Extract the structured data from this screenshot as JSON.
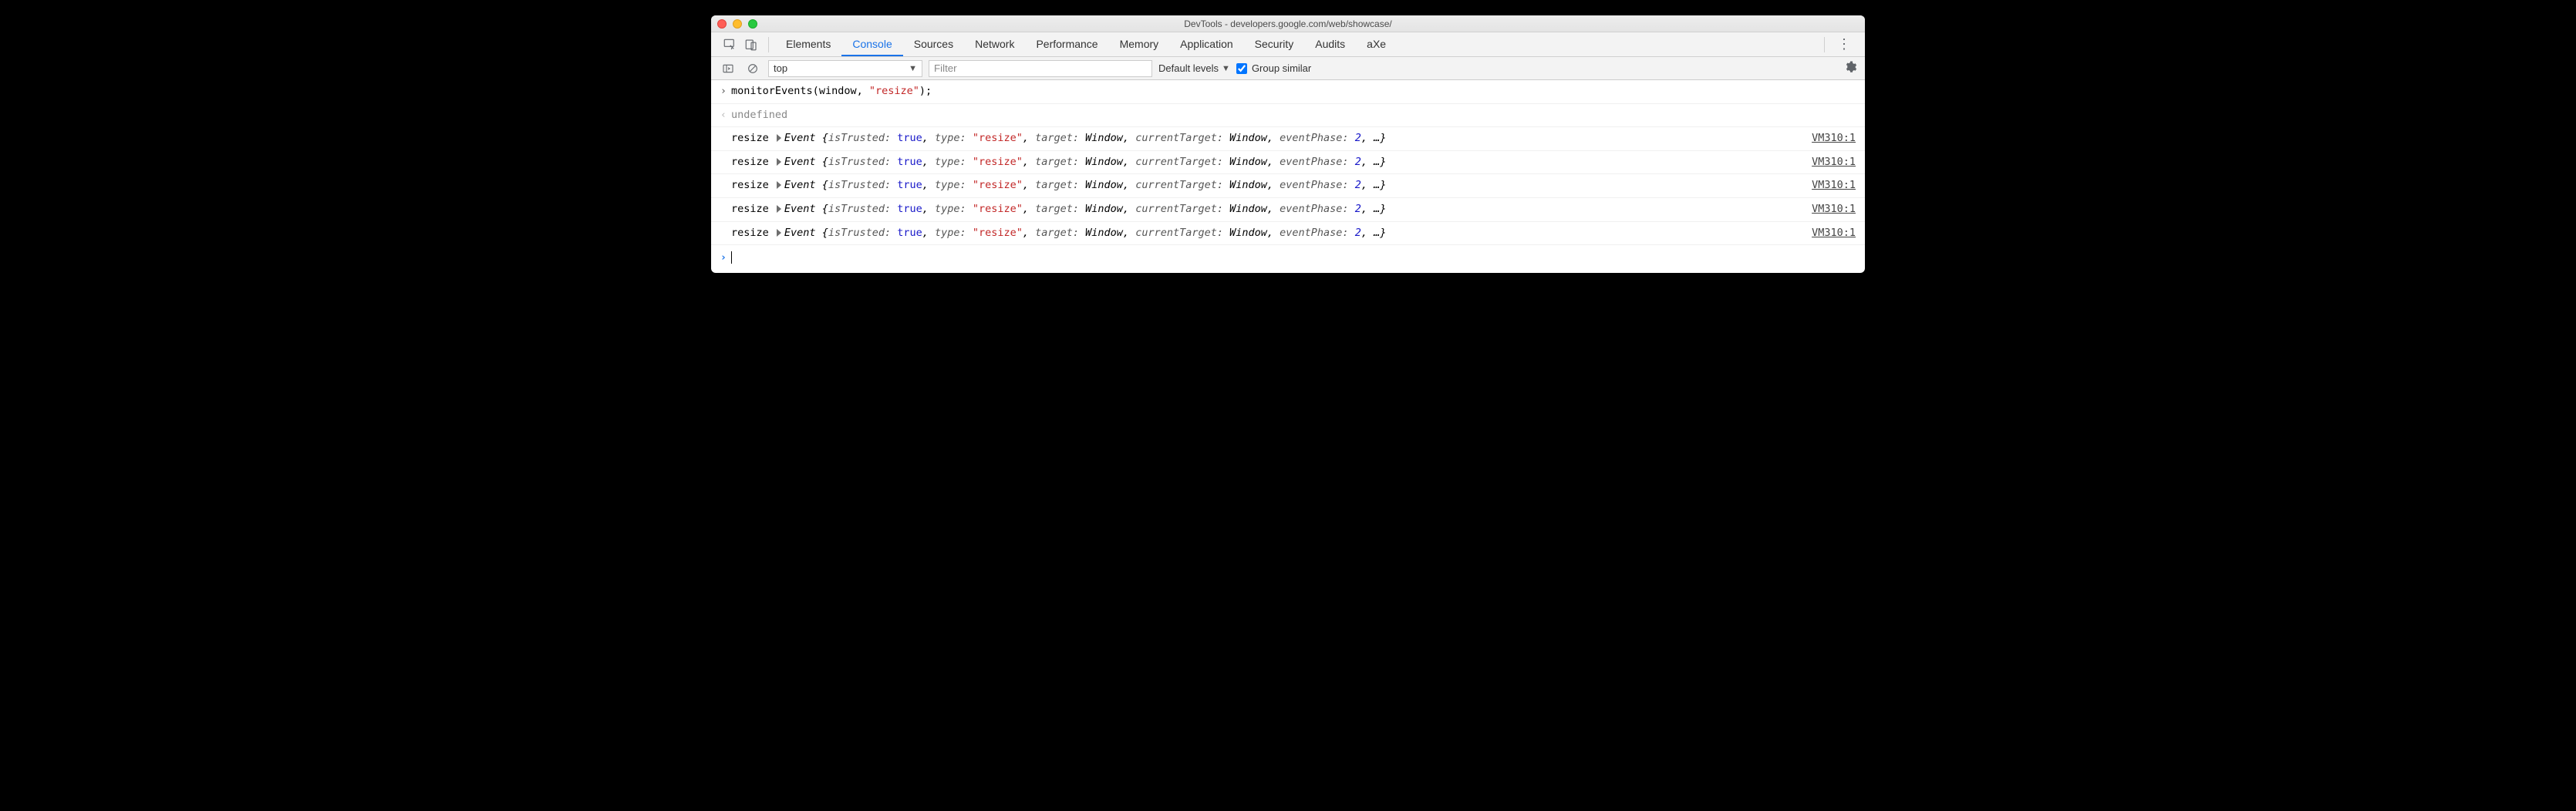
{
  "window": {
    "title": "DevTools - developers.google.com/web/showcase/"
  },
  "tabs": {
    "items": [
      "Elements",
      "Console",
      "Sources",
      "Network",
      "Performance",
      "Memory",
      "Application",
      "Security",
      "Audits",
      "aXe"
    ],
    "active_index": 1
  },
  "console_toolbar": {
    "context": "top",
    "filter_placeholder": "Filter",
    "levels_label": "Default levels",
    "group_similar_label": "Group similar",
    "group_similar_checked": true
  },
  "console": {
    "input_line": {
      "fn": "monitorEvents",
      "arg0": "window",
      "arg1": "\"resize\"",
      "close": ");"
    },
    "result": "undefined",
    "event_source": "VM310:1",
    "event_label": "resize",
    "event": {
      "ctor": "Event",
      "p0k": "isTrusted",
      "p0v": "true",
      "p1k": "type",
      "p1v": "\"resize\"",
      "p2k": "target",
      "p2v": "Window",
      "p3k": "currentTarget",
      "p3v": "Window",
      "p4k": "eventPhase",
      "p4v": "2",
      "more": "…"
    },
    "event_count": 5
  }
}
